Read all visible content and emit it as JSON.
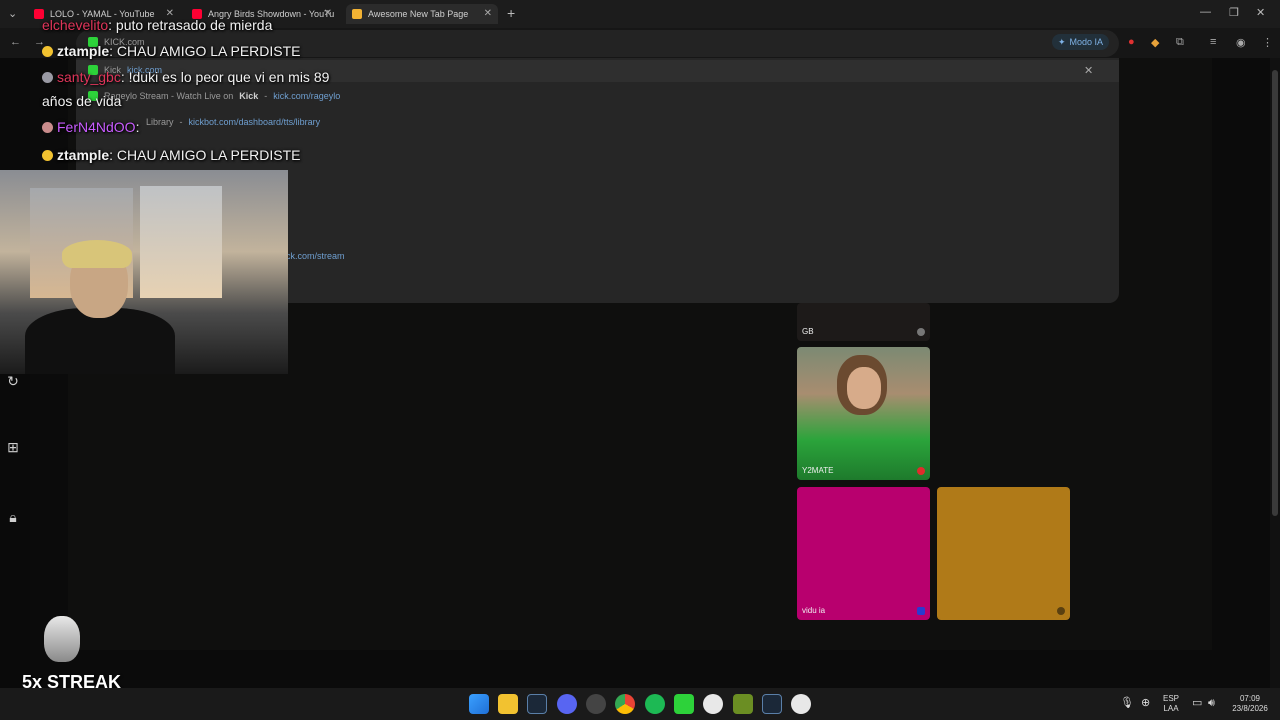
{
  "browser": {
    "tabs": [
      {
        "label": "LOLO - YAMAL - YouTube",
        "icon": "youtube-icon",
        "color": "#ff0033"
      },
      {
        "label": "Angry Birds Showdown - YouTu",
        "icon": "youtube-icon",
        "color": "#ff0033"
      },
      {
        "label": "Awesome New Tab Page",
        "icon": "grid-icon",
        "color": "#f2b233",
        "active": true
      }
    ],
    "modo_ia": "Modo IA"
  },
  "dropdown": {
    "rows": [
      {
        "title": "KICK.com",
        "url": ""
      },
      {
        "title": "Kick",
        "url": "kick.com"
      },
      {
        "title": "Rageylo Stream - Watch Live on",
        "bold": "Kick",
        "url": "kick.com/rageylo"
      },
      {
        "title": "Library",
        "url": "kickbot.com/dashboard/tts/library"
      },
      {
        "title": "",
        "url": "ck.com/stream"
      }
    ]
  },
  "chat": {
    "messages": [
      {
        "user": "elchevelito",
        "text": ": puto retrasado de mierda"
      },
      {
        "user": "ztample",
        "text": ": CHAU AMIGO LA PERDISTE"
      },
      {
        "user": "santy_gbc",
        "text": ": !duki es lo peor que vi en mis 89"
      },
      {
        "continuation": "años de vida"
      },
      {
        "user": "FerN4NdOO",
        "text": ":"
      },
      {
        "user": "ztample",
        "text": ": CHAU AMIGO LA PERDISTE"
      }
    ]
  },
  "tiles": [
    {
      "label": "GB",
      "color": "#1d1a19"
    },
    {
      "label": "Y2MATE",
      "color": "#5c6a56"
    },
    {
      "label": "vidu ia",
      "color": "#b8006e"
    },
    {
      "label": "",
      "color": "#b07a18"
    }
  ],
  "streak": {
    "label": "5x STREAK"
  },
  "taskbar": {
    "lang_top": "ESP",
    "lang_bottom": "LAA",
    "time": "07:09",
    "date": "23/8/2026"
  }
}
